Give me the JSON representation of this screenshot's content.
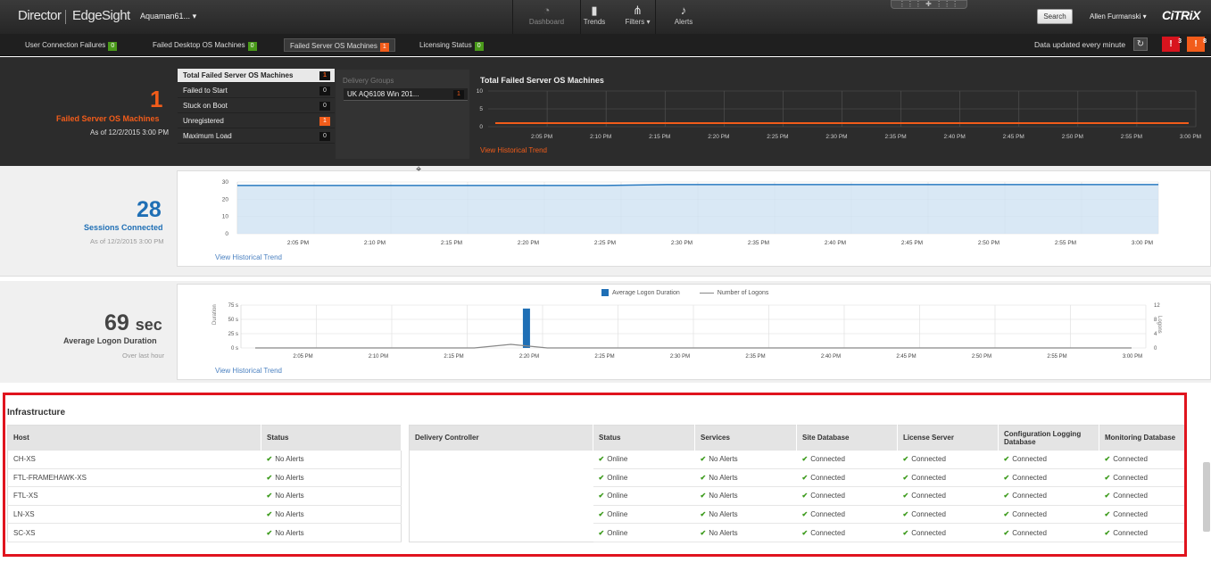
{
  "header": {
    "brand_director": "Director",
    "brand_edgesight": "EdgeSight",
    "site": "Aquaman61...",
    "nav": [
      {
        "label": "Dashboard",
        "icon": "dashboard-icon"
      },
      {
        "label": "Trends",
        "icon": "trends-icon"
      },
      {
        "label": "Filters",
        "icon": "filters-icon"
      },
      {
        "label": "Alerts",
        "icon": "bell-icon"
      }
    ],
    "search_label": "Search",
    "user": "Allen Furmanski",
    "logo": "CiTRiX"
  },
  "subbar": {
    "tabs": [
      {
        "label": "User Connection Failures",
        "count": "0",
        "color": "green"
      },
      {
        "label": "Failed Desktop OS Machines",
        "count": "0",
        "color": "green"
      },
      {
        "label": "Failed Server OS Machines",
        "count": "1",
        "color": "orange"
      },
      {
        "label": "Licensing Status",
        "count": "0",
        "color": "green"
      }
    ],
    "updated": "Data updated every minute",
    "alert_critical": "3",
    "alert_warning": "8"
  },
  "failed": {
    "count": "1",
    "title": "Failed Server OS Machines",
    "as_of": "As of 12/2/2015 3:00 PM",
    "rows": [
      {
        "label": "Total Failed Server OS Machines",
        "count": "1"
      },
      {
        "label": "Failed to Start",
        "count": "0"
      },
      {
        "label": "Stuck on Boot",
        "count": "0"
      },
      {
        "label": "Unregistered",
        "count": "1"
      },
      {
        "label": "Maximum Load",
        "count": "0"
      }
    ],
    "delivery_groups_label": "Delivery Groups",
    "delivery_group": {
      "name": "UK AQ6108 Win 201...",
      "count": "1"
    },
    "chart_title": "Total Failed Server OS Machines",
    "view_link": "View Historical Trend"
  },
  "sessions": {
    "count": "28",
    "title": "Sessions Connected",
    "as_of": "As of 12/2/2015 3:00 PM",
    "view_link": "View Historical Trend"
  },
  "logon": {
    "value": "69",
    "unit": "sec",
    "title": "Average Logon Duration",
    "sub": "Over last hour",
    "view_link": "View Historical Trend",
    "legend_bar": "Average Logon Duration",
    "legend_line": "Number of Logons",
    "y_left_label": "Duration",
    "y_right_label": "Logons"
  },
  "chart_data": [
    {
      "type": "line",
      "title": "Total Failed Server OS Machines",
      "x": [
        "2:05 PM",
        "2:10 PM",
        "2:15 PM",
        "2:20 PM",
        "2:25 PM",
        "2:30 PM",
        "2:35 PM",
        "2:40 PM",
        "2:45 PM",
        "2:50 PM",
        "2:55 PM",
        "3:00 PM"
      ],
      "yticks": [
        "10",
        "5",
        "0"
      ],
      "ylim": [
        0,
        10
      ],
      "series": [
        {
          "values": [
            1,
            1,
            1,
            1,
            1,
            1,
            1,
            1,
            1,
            1,
            1,
            1,
            1
          ],
          "color": "#f25c1a"
        }
      ]
    },
    {
      "type": "area",
      "title": "",
      "x": [
        "2:05 PM",
        "2:10 PM",
        "2:15 PM",
        "2:20 PM",
        "2:25 PM",
        "2:30 PM",
        "2:35 PM",
        "2:40 PM",
        "2:45 PM",
        "2:50 PM",
        "2:55 PM",
        "3:00 PM"
      ],
      "yticks": [
        "30",
        "20",
        "10",
        "0"
      ],
      "ylim": [
        0,
        30
      ],
      "series": [
        {
          "values": [
            28,
            28,
            28,
            28,
            28,
            28,
            28,
            28.5,
            28.5,
            28.5,
            28.5,
            28.5,
            28.5,
            28.5,
            28.5,
            28.5
          ],
          "color": "#2a7ac0"
        }
      ]
    },
    {
      "type": "bar",
      "title": "",
      "x": [
        "2:05 PM",
        "2:10 PM",
        "2:15 PM",
        "2:20 PM",
        "2:25 PM",
        "2:30 PM",
        "2:35 PM",
        "2:40 PM",
        "2:45 PM",
        "2:50 PM",
        "2:55 PM",
        "3:00 PM"
      ],
      "yticks_left": [
        "75 s",
        "50 s",
        "25 s",
        "0 s"
      ],
      "yticks_right": [
        "12",
        "8",
        "4",
        "0"
      ],
      "ylim": [
        0,
        75
      ],
      "series": [
        {
          "name": "Average Logon Duration",
          "bar_at": "2:19 PM",
          "value": 69,
          "color": "#1f6fb5"
        },
        {
          "name": "Number of Logons",
          "values": [
            0,
            0,
            0,
            0,
            0,
            0,
            0,
            1,
            0,
            0,
            0,
            0,
            0,
            0,
            0,
            0,
            0,
            0,
            0,
            0,
            0,
            0,
            0,
            0,
            0
          ],
          "color": "#888"
        }
      ]
    }
  ],
  "infra": {
    "title": "Infrastructure",
    "host_headers": [
      "Host",
      "Status"
    ],
    "hosts": [
      {
        "host": "CH-XS",
        "status": "No Alerts"
      },
      {
        "host": "FTL-FRAMEHAWK-XS",
        "status": "No Alerts"
      },
      {
        "host": "FTL-XS",
        "status": "No Alerts"
      },
      {
        "host": "LN-XS",
        "status": "No Alerts"
      },
      {
        "host": "SC-XS",
        "status": "No Alerts"
      }
    ],
    "dc_headers": [
      "Delivery Controller",
      "Status",
      "Services",
      "Site Database",
      "License Server",
      "Configuration Logging Database",
      "Monitoring Database"
    ],
    "controllers": [
      {
        "dc": "",
        "status": "Online",
        "services": "No Alerts",
        "site": "Connected",
        "license": "Connected",
        "config": "Connected",
        "monitor": "Connected"
      },
      {
        "dc": "",
        "status": "Online",
        "services": "No Alerts",
        "site": "Connected",
        "license": "Connected",
        "config": "Connected",
        "monitor": "Connected"
      },
      {
        "dc": "",
        "status": "Online",
        "services": "No Alerts",
        "site": "Connected",
        "license": "Connected",
        "config": "Connected",
        "monitor": "Connected"
      },
      {
        "dc": "",
        "status": "Online",
        "services": "No Alerts",
        "site": "Connected",
        "license": "Connected",
        "config": "Connected",
        "monitor": "Connected"
      },
      {
        "dc": "",
        "status": "Online",
        "services": "No Alerts",
        "site": "Connected",
        "license": "Connected",
        "config": "Connected",
        "monitor": "Connected"
      }
    ]
  }
}
